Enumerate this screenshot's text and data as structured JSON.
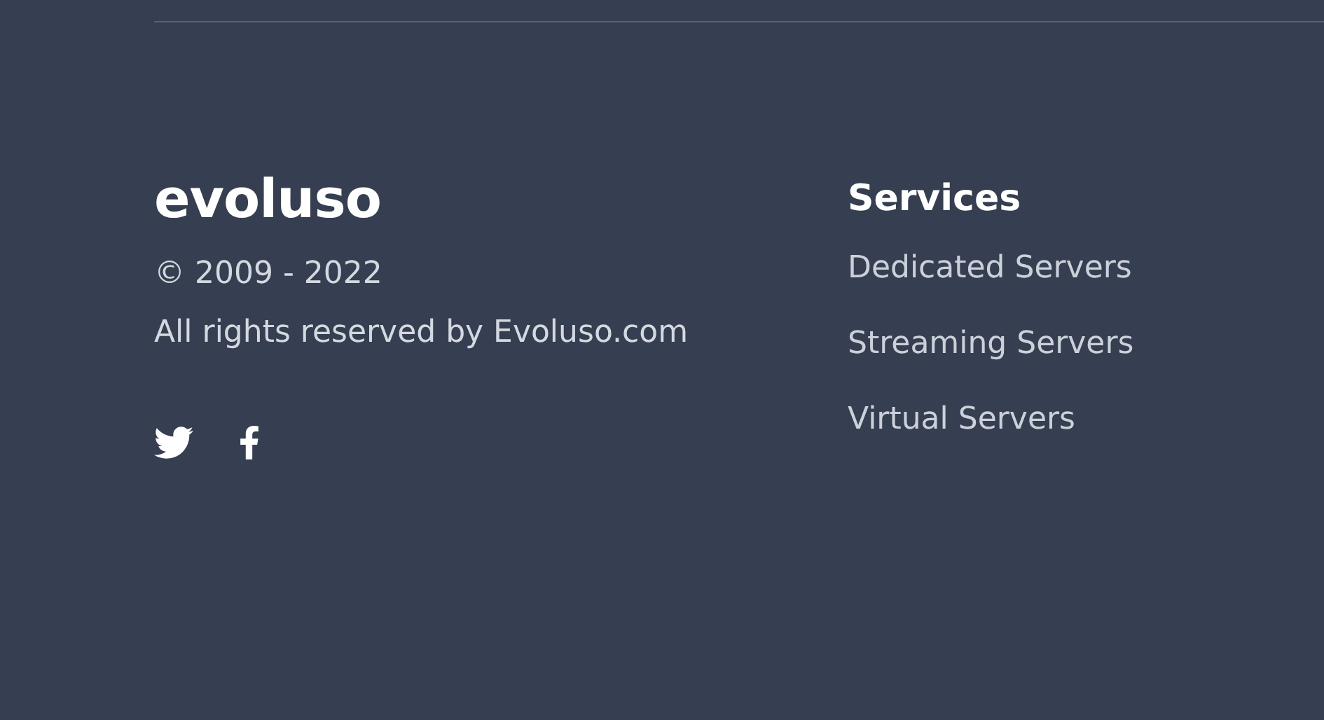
{
  "brand": {
    "logo": "evoluso",
    "copyright": "© 2009 - 2022",
    "rights": "All rights reserved by Evoluso.com"
  },
  "services": {
    "heading": "Services",
    "links": [
      "Dedicated Servers",
      "Streaming Servers",
      "Virtual Servers"
    ]
  }
}
